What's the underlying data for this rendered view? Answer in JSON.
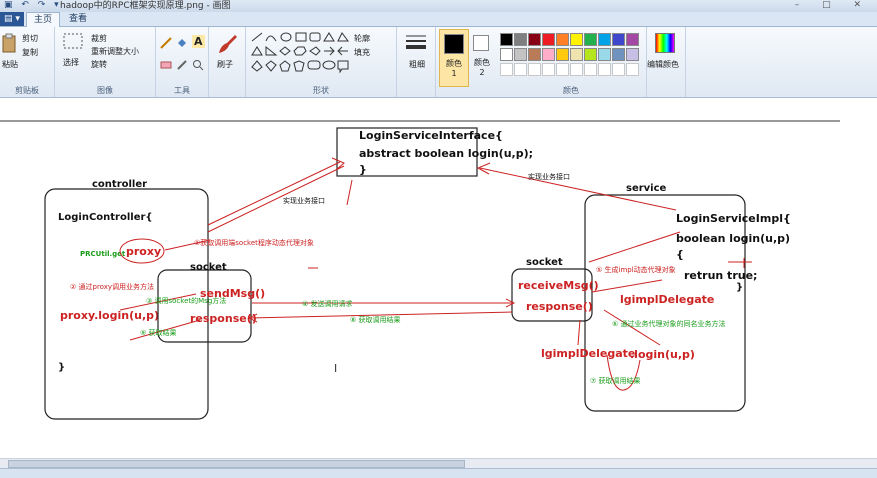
{
  "window": {
    "title": "hadoop中的RPC框架实现原理.png - 画图"
  },
  "tabs": [
    {
      "label": "主页",
      "active": true
    },
    {
      "label": "查看",
      "active": false
    }
  ],
  "ribbon": {
    "clipboard": {
      "paste": "粘贴",
      "cut": "剪切",
      "copy": "复制",
      "label": "剪贴板"
    },
    "image": {
      "select": "选择",
      "crop": "裁剪",
      "resize": "重新调整大小",
      "rotate": "旋转",
      "label": "图像"
    },
    "tools": {
      "label": "工具"
    },
    "brushes": {
      "label": "刷子"
    },
    "shapes": {
      "outline": "轮廓",
      "fill": "填充",
      "label": "形状"
    },
    "size": {
      "label": "粗细"
    },
    "color1": {
      "label": "颜色 1"
    },
    "color2": {
      "label": "颜色 2"
    },
    "edit_colors": {
      "label": "编辑颜色"
    },
    "colors_label": "颜色",
    "palette": [
      "#000000",
      "#7f7f7f",
      "#880015",
      "#ed1c24",
      "#ff7f27",
      "#fff200",
      "#22b14c",
      "#00a2e8",
      "#3f48cc",
      "#a349a4",
      "#ffffff",
      "#c3c3c3",
      "#b97a57",
      "#ffaec9",
      "#ffc90e",
      "#efe4b0",
      "#b5e61d",
      "#99d9ea",
      "#7092be",
      "#c8bfe7"
    ]
  },
  "diagram": {
    "interface_box": {
      "line1": "LoginServiceInterface{",
      "line2": "abstract boolean login(u,p);",
      "line3": "}"
    },
    "controller": {
      "title": "controller",
      "class_line": "LoginController{",
      "prcutil": "PRCUtil.get",
      "proxy": "proxy",
      "proxy_call": "proxy.login(u,p)",
      "close_brace": "}"
    },
    "socket_left": {
      "title": "socket",
      "send": "sendMsg()",
      "response": "response()"
    },
    "service": {
      "title": "service",
      "class_line": "LoginServiceImpl{",
      "method": "boolean login(u,p)",
      "brace": "{",
      "retrun": "retrun true;",
      "close_brace": "}"
    },
    "socket_right": {
      "title": "socket",
      "receive": "receiveMsg()",
      "response": "response()"
    },
    "delegates": {
      "d1": "lgimplDelegate",
      "d2": "lgimplDelegate",
      "login": ".login(u,p)"
    },
    "annotations": {
      "impl_left": "实现业务接口",
      "impl_right": "实现业务接口",
      "a1": "①获取调用端socket程序动态代理对象",
      "a2": "② 通过proxy调用业务方法",
      "a3": "③ 调用socket的Msg方法",
      "a4": "④ 发送调用请求",
      "a5": "⑤ 生成impl动态代理对象",
      "a6": "⑥ 通过业务代理对象的同名业务方法",
      "a7": "⑦ 获取调用结果",
      "a8": "⑧ 获取调用结果",
      "a9": "⑨ 获取结果"
    }
  }
}
